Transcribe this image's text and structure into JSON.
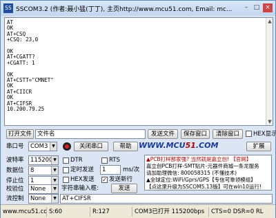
{
  "window": {
    "title": "SSCOM3.2 (作者:聂小猛(丁丁), 主页http://www.mcu51.com,  Email: mc...",
    "app_icon_text": "SS"
  },
  "terminal": {
    "lines": [
      "AT",
      "OK",
      "AT+CSQ",
      "+CSQ: 23,0",
      "",
      "OK",
      "AT+CGATT?",
      "+CGATT: 1",
      "",
      "OK",
      "AT+CSTT=\"CMNET\"",
      "OK",
      "AT+CIICR",
      "OK",
      "AT+CIFSR",
      "10.200.79.25"
    ]
  },
  "file_row": {
    "open_file": "打开文件",
    "file_name": "文件名",
    "send_file": "发送文件",
    "save_window": "保存窗口",
    "clear_window": "清除窗口",
    "hex_display": "HEX显示"
  },
  "port_row": {
    "port_label": "串口号",
    "port_value": "COM3",
    "close_port": "关闭串口",
    "help": "帮助",
    "expand": "扩展"
  },
  "settings": {
    "baud_label": "波特率",
    "baud_value": "115200",
    "data_label": "数据位",
    "data_value": "8",
    "stop_label": "停止位",
    "stop_value": "1",
    "parity_label": "校验位",
    "parity_value": "None",
    "flow_label": "流控制",
    "flow_value": "None"
  },
  "options": {
    "dtr": "DTR",
    "rts": "RTS",
    "timed_send": "定时发送",
    "interval_value": "1",
    "interval_unit": "ms/次",
    "hex_send": "HEX发送",
    "send_newline": "发送新行",
    "input_label": "字符串输入框:",
    "send_button": "发送",
    "send_text": "AT+CIFSR"
  },
  "logo": {
    "prefix": "WWW.MCU",
    "num": "51",
    "suffix": ".COM"
  },
  "ad": {
    "lines": [
      "▲PCB打样那家强? 当然就是嘉立创! 【官网】",
      "嘉立创PCB打样-SMT贴片-元器件商城一条龙服务",
      "请加助理微信: 800058315 (不懂技术)",
      "▲全球定位:WiFi/Gprs/GPS【专信可靠领模组】",
      "【点这里升级为SSCOM5.13版】可在win10运行!"
    ]
  },
  "status": {
    "site": "www.mcu51.cor",
    "s": "S:60",
    "r": "R:127",
    "port_state": "COM3已打开  115200bps",
    "signals": "CTS=0 DSR=0 RL"
  }
}
